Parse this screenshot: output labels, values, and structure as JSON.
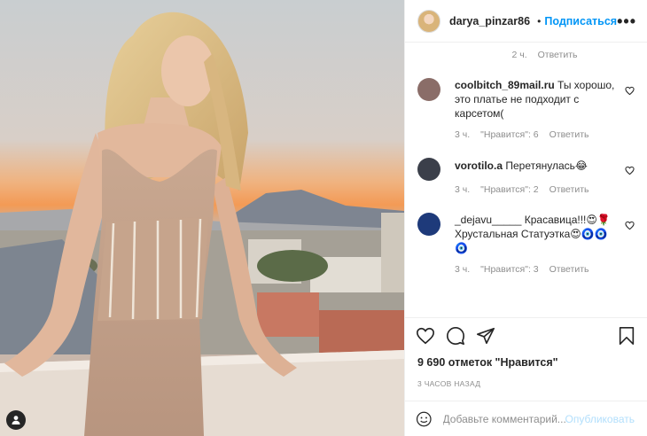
{
  "post": {
    "author": "darya_pinzar86",
    "follow_label": "Подписаться",
    "more_label": "•••",
    "caption_time": "2 ч.",
    "caption_reply": "Ответить"
  },
  "comments": [
    {
      "user": "coolbitch_89mail.ru",
      "text": "Ты хорошо, это платье не подходит с карсетом(",
      "time": "3 ч.",
      "likes": "\"Нравится\": 6",
      "reply": "Ответить",
      "avatar_color": "#8a6d68"
    },
    {
      "user": "vorotilo.a",
      "text": "Перетянулась😂",
      "time": "3 ч.",
      "likes": "\"Нравится\": 2",
      "reply": "Ответить",
      "avatar_color": "#3b3f4a"
    },
    {
      "user": "_dejavu_____",
      "text": "Красавица!!!😍🌹 Хрустальная Статуэтка😍🧿🧿🧿",
      "time": "3 ч.",
      "likes": "\"Нравится\": 3",
      "reply": "Ответить",
      "avatar_color": "#1e3a7a"
    }
  ],
  "stats": {
    "likes_text": "9 690 отметок \"Нравится\"",
    "posted_ago": "3 часов назад"
  },
  "composer": {
    "placeholder": "Добавьте комментарий...",
    "publish_label": "Опубликовать"
  },
  "icons": {
    "like": "heart-icon",
    "comment": "comment-icon",
    "share": "share-icon",
    "save": "bookmark-icon",
    "emoji": "emoji-icon",
    "verified": "verified-badge-icon",
    "tag": "user-tag-icon"
  },
  "colors": {
    "accent": "#0095f6",
    "publish_disabled": "#b2dffc",
    "muted": "#8e8e8e"
  }
}
